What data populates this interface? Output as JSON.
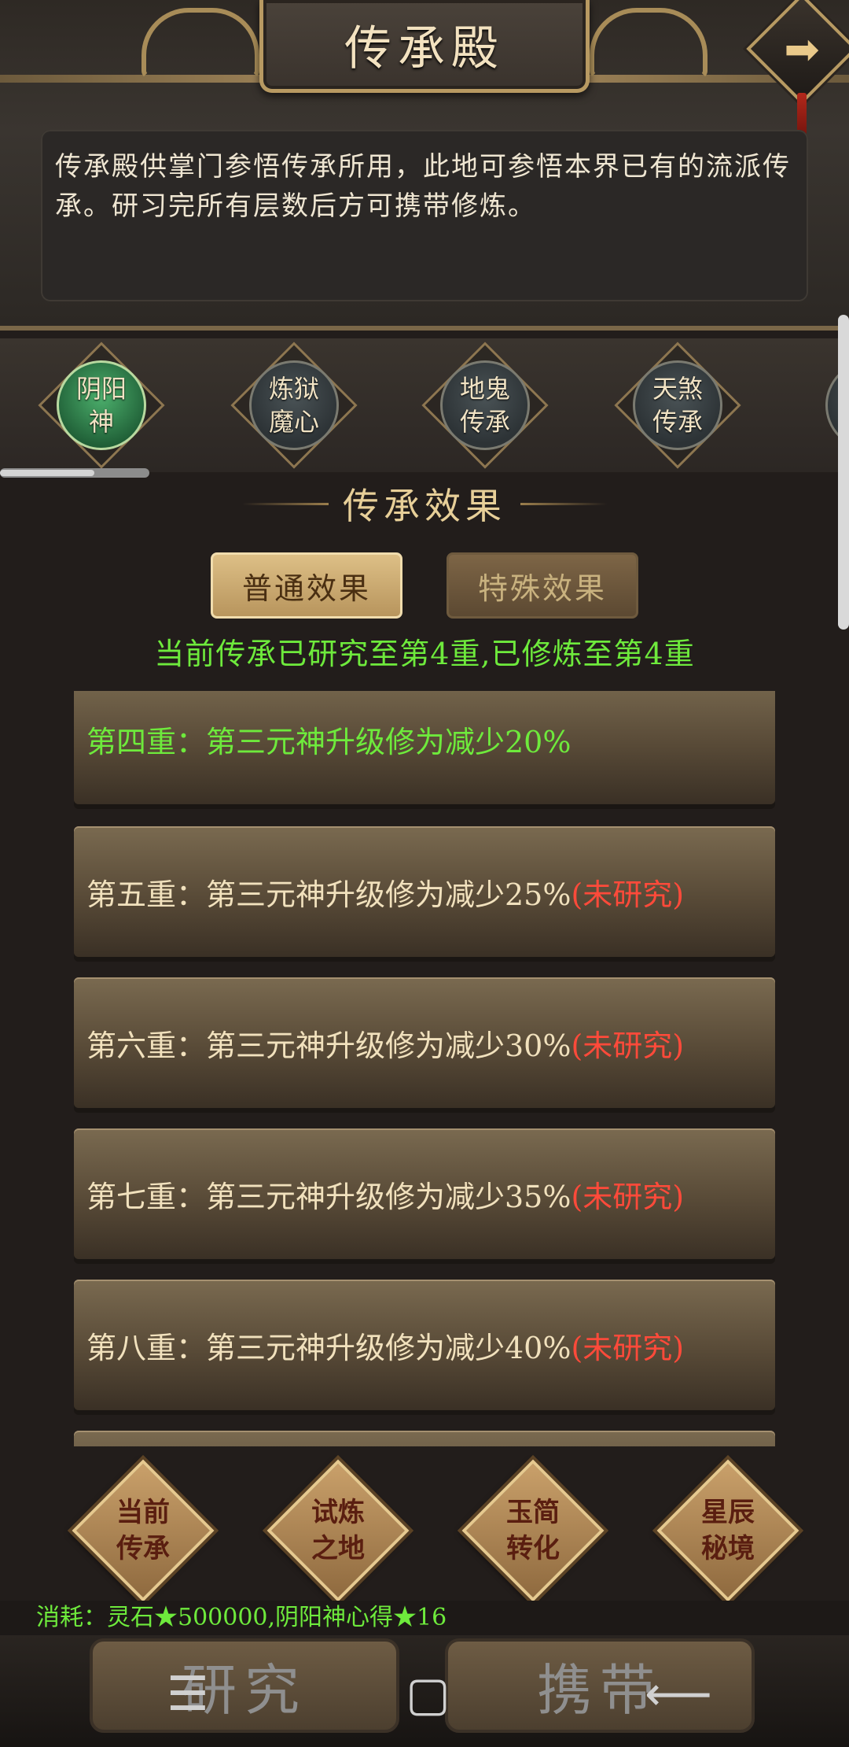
{
  "header": {
    "title": "传承殿",
    "next_icon": "arrow-right-icon",
    "description": "传承殿供掌门参悟传承所用，此地可参悟本界已有的流派传承。研习完所有层数后方可携带修炼。"
  },
  "lineages": [
    {
      "label": "阴阳神",
      "active": true
    },
    {
      "label": "炼狱魔心",
      "active": false
    },
    {
      "label": "地鬼传承",
      "active": false
    },
    {
      "label": "天煞传承",
      "active": false
    }
  ],
  "effects": {
    "section_title": "传承效果",
    "tabs": {
      "normal": "普通效果",
      "special": "特殊效果"
    },
    "status": "当前传承已研究至第4重,已修炼至第4重",
    "rows": [
      {
        "text": "第四重：第三元神升级修为减少20%",
        "status": ""
      },
      {
        "text": "第五重：第三元神升级修为减少25%",
        "status": "(未研究)"
      },
      {
        "text": "第六重：第三元神升级修为减少30%",
        "status": "(未研究)"
      },
      {
        "text": "第七重：第三元神升级修为减少35%",
        "status": "(未研究)"
      },
      {
        "text": "第八重：第三元神升级修为减少40%",
        "status": "(未研究)"
      }
    ]
  },
  "functions": [
    {
      "label_line1": "当前",
      "label_line2": "传承"
    },
    {
      "label_line1": "试炼",
      "label_line2": "之地"
    },
    {
      "label_line1": "玉简",
      "label_line2": "转化"
    },
    {
      "label_line1": "星辰",
      "label_line2": "秘境"
    }
  ],
  "cost": "消耗：灵石★500000,阴阳神心得★16",
  "actions": {
    "research": "研究",
    "carry": "携带"
  },
  "colors": {
    "done": "#6eea3c",
    "not_researched": "#ff4a3a",
    "gold": "#e7cf98"
  }
}
